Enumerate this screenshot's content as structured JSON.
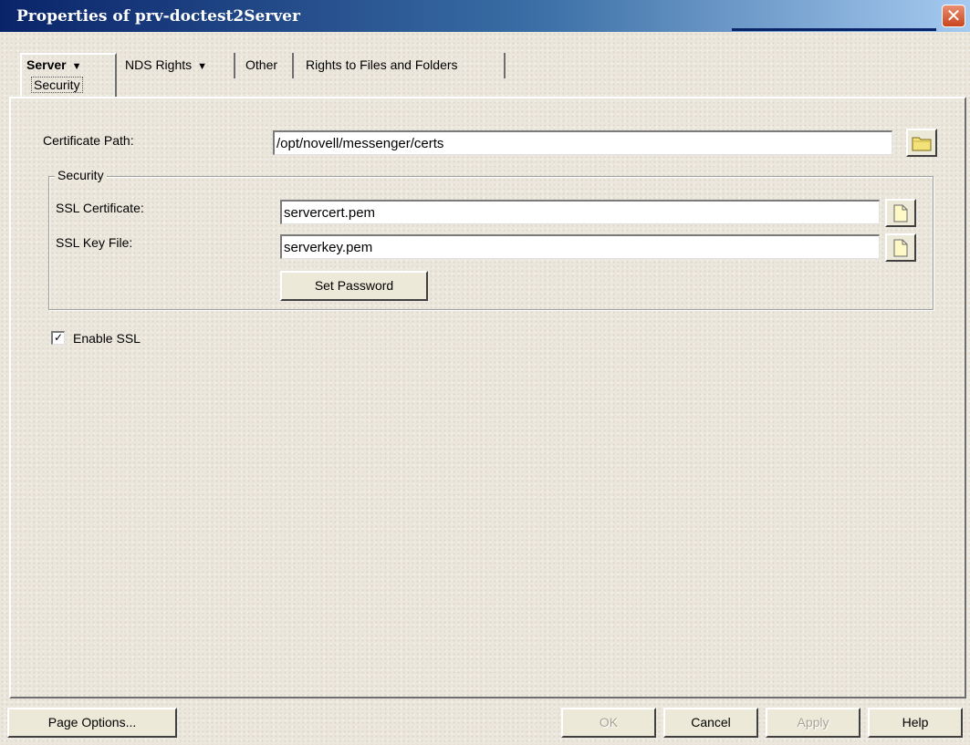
{
  "window": {
    "title": "Properties of prv-doctest2Server"
  },
  "tabs": [
    {
      "label": "Server",
      "dropdown": true,
      "active": true
    },
    {
      "label": "NDS Rights",
      "dropdown": true,
      "active": false
    },
    {
      "label": "Other",
      "dropdown": false,
      "active": false
    },
    {
      "label": "Rights to Files and Folders",
      "dropdown": false,
      "active": false
    }
  ],
  "subtab": {
    "label": "Security"
  },
  "form": {
    "certificate_path_label": "Certificate Path:",
    "certificate_path_value": "/opt/novell/messenger/certs",
    "security_group": {
      "legend": "Security",
      "ssl_certificate_label": "SSL Certificate:",
      "ssl_certificate_value": "servercert.pem",
      "ssl_key_file_label": "SSL Key File:",
      "ssl_key_file_value": "serverkey.pem",
      "set_password_label": "Set Password"
    },
    "enable_ssl_label": "Enable SSL",
    "enable_ssl_checked": true
  },
  "footer": {
    "page_options_label": "Page Options...",
    "ok_label": "OK",
    "cancel_label": "Cancel",
    "apply_label": "Apply",
    "help_label": "Help"
  },
  "icons": {
    "close": "close-icon",
    "browse_folder": "folder-icon",
    "browse_file": "file-icon",
    "tab_dropdown": "caret-down-icon"
  },
  "colors": {
    "titlebar_start": "#0a246a",
    "titlebar_end": "#a6caf0",
    "close_button": "#c9451c",
    "dialog_background": "#ebe7dc"
  }
}
